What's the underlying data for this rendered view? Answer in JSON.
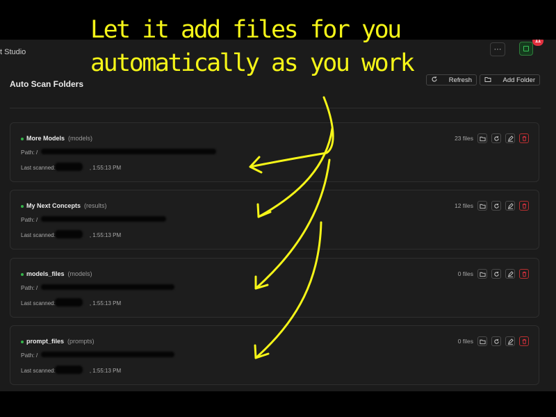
{
  "app": {
    "title_fragment": "t Studio",
    "menu_label": "···",
    "notification_count": "11"
  },
  "header": {
    "title": "Auto Scan Folders",
    "refresh_label": "Refresh",
    "add_folder_label": "Add Folder"
  },
  "labels": {
    "path": "Path:",
    "last_scanned": "Last scanned:"
  },
  "folders": [
    {
      "name": "More Models",
      "type": "(models)",
      "path_prefix": "/",
      "files": "23 files",
      "time": ", 1:55:13 PM"
    },
    {
      "name": "My Next Concepts",
      "type": "(results)",
      "path_prefix": "/",
      "files": "12 files",
      "time": ", 1:55:13 PM"
    },
    {
      "name": "models_files",
      "type": "(models)",
      "path_prefix": "/",
      "files": "0 files",
      "time": ", 1:55:13 PM"
    },
    {
      "name": "prompt_files",
      "type": "(prompts)",
      "path_prefix": "/",
      "files": "0 files",
      "time": ", 1:55:13 PM"
    }
  ],
  "annotation": {
    "line1": "Let it add files for you",
    "line2": "automatically as you work"
  },
  "colors": {
    "background": "#1b1b1b",
    "annotation": "#f5f518",
    "status_dot": "#35b44a",
    "delete": "#e0313f",
    "badge": "#e0313f"
  },
  "icons": {
    "refresh": "refresh-icon",
    "add_folder": "folder-icon",
    "folder": "folder-icon",
    "rescan": "refresh-icon",
    "edit": "pencil-icon",
    "delete": "trash-icon",
    "notifications": "notification-icon",
    "menu": "more-icon"
  }
}
